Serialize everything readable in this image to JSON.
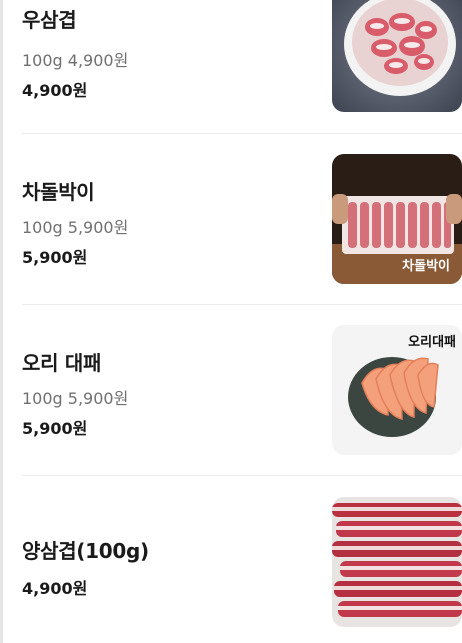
{
  "menu": {
    "items": [
      {
        "name": "우삼겹",
        "desc": "100g 4,900원",
        "price": "4,900원",
        "image_label": ""
      },
      {
        "name": "차돌박이",
        "desc": "100g 5,900원",
        "price": "5,900원",
        "image_label": "차돌박이"
      },
      {
        "name": "오리 대패",
        "desc": "100g 5,900원",
        "price": "5,900원",
        "image_label": "오리대패"
      },
      {
        "name": "양삼겹(100g)",
        "desc": "",
        "price": "4,900원",
        "image_label": ""
      }
    ]
  },
  "colors": {
    "divider": "#ececec",
    "text_primary": "#1a1a1a",
    "text_secondary": "#707070"
  }
}
